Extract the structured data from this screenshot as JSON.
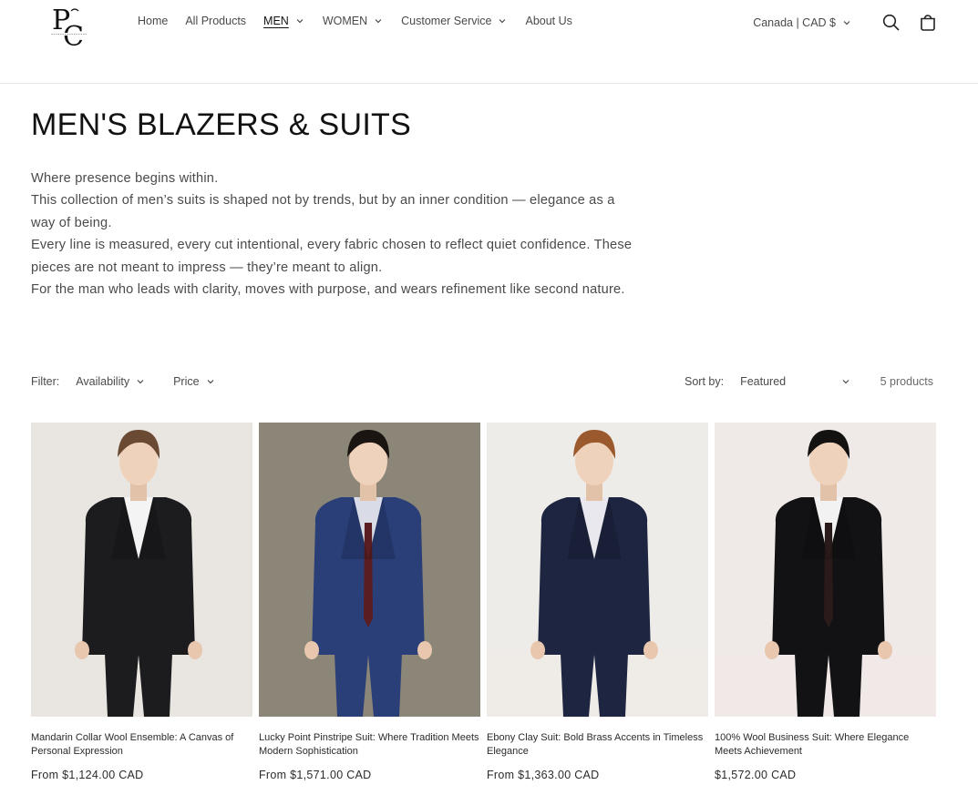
{
  "header": {
    "logo_alt": "Bouquet Style logo",
    "nav": [
      {
        "label": "Home",
        "has_dropdown": false,
        "active": false
      },
      {
        "label": "All Products",
        "has_dropdown": false,
        "active": false
      },
      {
        "label": "MEN",
        "has_dropdown": true,
        "active": true
      },
      {
        "label": "WOMEN",
        "has_dropdown": true,
        "active": false
      },
      {
        "label": "Customer Service",
        "has_dropdown": true,
        "active": false
      },
      {
        "label": "About Us",
        "has_dropdown": false,
        "active": false
      }
    ],
    "locale": "Canada | CAD $",
    "search_icon": "search-icon",
    "cart_icon": "cart-icon"
  },
  "collection": {
    "title": "MEN'S BLAZERS & SUITS",
    "description": [
      "Where presence begins within.",
      "This collection of men’s suits is shaped not by trends, but by an inner condition — elegance as a way of being.",
      "Every line is measured, every cut intentional, every fabric chosen to reflect quiet confidence. These pieces are not meant to impress — they’re meant to align.",
      "For the man who leads with clarity, moves with purpose, and wears refinement like second nature."
    ]
  },
  "filters": {
    "label": "Filter:",
    "availability": "Availability",
    "price": "Price",
    "sort_label": "Sort by:",
    "sort_value": "Featured",
    "count": "5 products"
  },
  "products": [
    {
      "name": "Mandarin Collar Wool Ensemble: A Canvas of Personal Expression",
      "price": "From $1,124.00 CAD",
      "bg": "#e9e6e1",
      "suit": "#1c1c1f",
      "shirt": "#f4f4f4",
      "hair": "#6b4a33",
      "tie": ""
    },
    {
      "name": "Lucky Point Pinstripe Suit: Where Tradition Meets Modern Sophistication",
      "price": "From $1,571.00 CAD",
      "bg": "#8c8678",
      "suit": "#2a3f78",
      "shirt": "#d9dce6",
      "hair": "#1b1512",
      "tie": "#5a1d22"
    },
    {
      "name": "Ebony Clay Suit: Bold Brass Accents in Timeless Elegance",
      "price": "From $1,363.00 CAD",
      "bg": "#eeece8",
      "suit": "#1d2540",
      "shirt": "#e8e8ee",
      "hair": "#9a5a2e",
      "tie": ""
    },
    {
      "name": "100% Wool Business Suit: Where Elegance Meets Achievement",
      "price": "$1,572.00 CAD",
      "bg": "#efe9e7",
      "suit": "#121214",
      "shirt": "#f2f2f2",
      "hair": "#141210",
      "tie": "#2a1a1a"
    }
  ]
}
